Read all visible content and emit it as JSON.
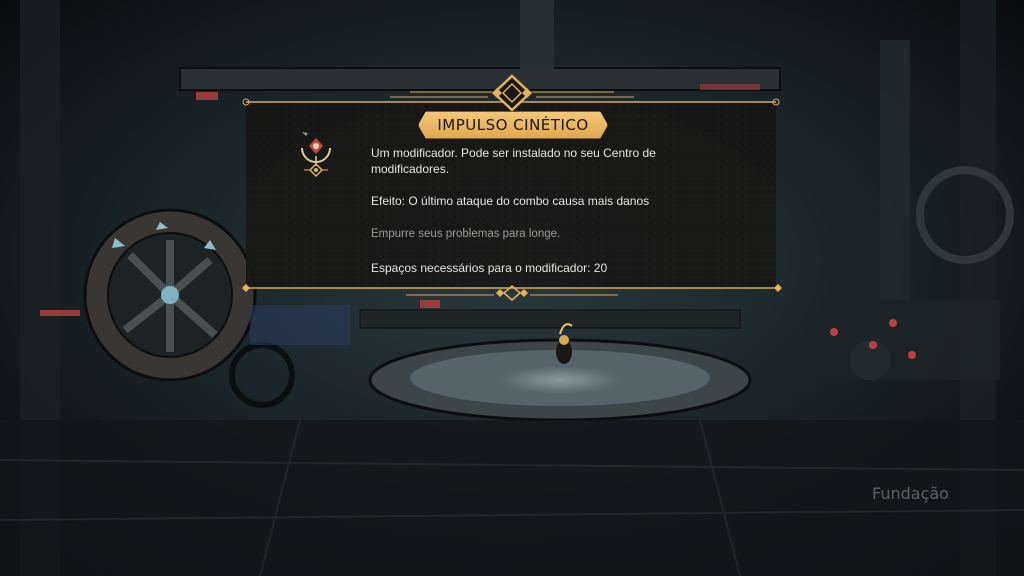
{
  "modifier": {
    "title": "IMPULSO CINÉTICO",
    "description": "Um modificador. Pode ser instalado no seu Centro de modificadores.",
    "effect": "Efeito: O último ataque do combo causa mais danos",
    "flavor": "Empurre seus problemas para longe.",
    "slots": "Espaços necessários para o modificador: 20",
    "icon": "kinetic-impulse-modifier-icon"
  },
  "location": {
    "name": "Fundação"
  },
  "colors": {
    "accent_gold": "#f0c070",
    "panel_bg": "#181715",
    "text_main": "#e8e6e2",
    "text_muted": "#9c9a96"
  }
}
